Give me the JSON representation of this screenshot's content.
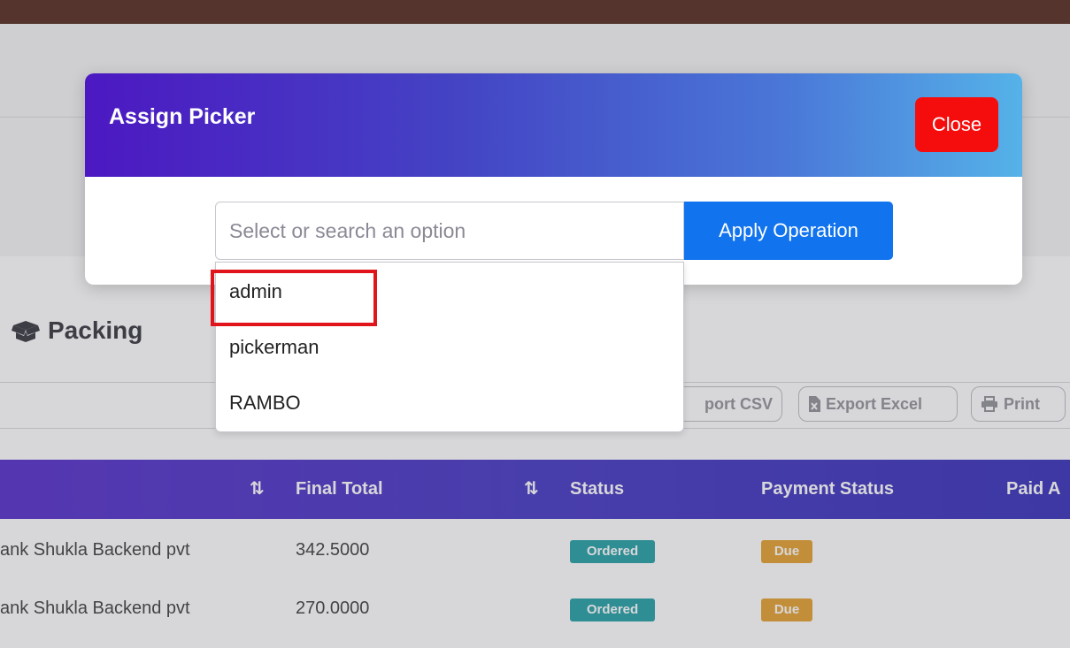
{
  "page": {
    "section_title": "Packing",
    "toolbar": {
      "export_csv": "port CSV",
      "export_excel": "Export Excel",
      "print": "Print"
    },
    "table": {
      "headers": [
        "Final Total",
        "Status",
        "Payment Status",
        "Paid A"
      ],
      "rows": [
        {
          "customer": "ank Shukla Backend pvt",
          "final_total": "342.5000",
          "status": "Ordered",
          "payment_status": "Due"
        },
        {
          "customer": "ank Shukla Backend pvt",
          "final_total": "270.0000",
          "status": "Ordered",
          "payment_status": "Due"
        }
      ]
    }
  },
  "modal": {
    "title": "Assign Picker",
    "close_label": "Close",
    "select_placeholder": "Select or search an option",
    "apply_label": "Apply Operation",
    "options": [
      "admin",
      "pickerman",
      "RAMBO"
    ]
  },
  "colors": {
    "close": "#f50d0d",
    "apply": "#1173ee",
    "status_badge": "#169aa0",
    "due_badge": "#e39a22",
    "highlight": "#e0141a"
  }
}
